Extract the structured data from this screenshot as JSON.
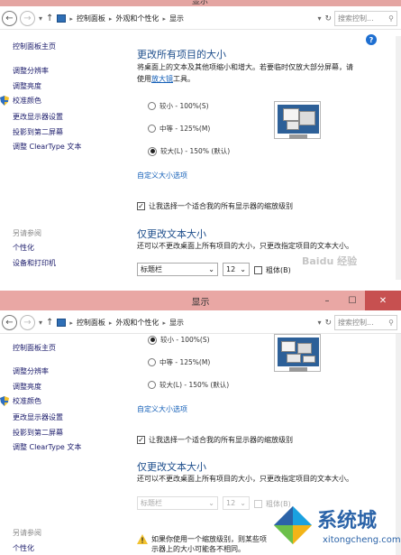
{
  "window": {
    "title": "显示"
  },
  "address": {
    "crumbs": [
      "控制面板",
      "外观和个性化",
      "显示"
    ],
    "search_placeholder": "搜索控制..."
  },
  "sidebar": {
    "home": "控制面板主页",
    "links": [
      "调整分辨率",
      "调整亮度",
      "校准颜色",
      "更改显示器设置",
      "投影到第二屏幕",
      "调整 ClearType 文本"
    ],
    "see_also_title": "另请参阅",
    "see_also": [
      "个性化",
      "设备和打印机"
    ]
  },
  "main": {
    "heading_size": "更改所有项目的大小",
    "desc_line1": "将桌面上的文本及其他项缩小和增大。若要临时仅放大部分屏幕，请",
    "desc_line2_prefix": "使用",
    "magnifier_link": "放大镜",
    "desc_line2_suffix": "工具。",
    "options": [
      "较小 - 100%(S)",
      "中等 - 125%(M)",
      "较大(L) - 150% (默认)"
    ],
    "selected_option_panel1": 2,
    "selected_option_panel2": 0,
    "custom_link": "自定义大小选项",
    "scale_checkbox_label": "让我选择一个适合我的所有显示器的缩放级别",
    "scale_checkbox_checked": true,
    "heading_text": "仅更改文本大小",
    "text_desc": "还可以不更改桌面上所有项目的大小，只更改指定项目的文本大小。",
    "item_select": "标题栏",
    "size_select": "12",
    "bold_label": "粗体(B)",
    "warning": [
      "如果你使用一个缩放级别，则某些项",
      "示器上的大小可能各不相同。"
    ]
  },
  "watermark": "Baidu 经验",
  "logo": {
    "text_cn": "系统城",
    "text_en": "xitongcheng.com",
    "colors": [
      "#1aa1e0",
      "#2b63a8",
      "#6cc04a",
      "#f2b418"
    ]
  }
}
